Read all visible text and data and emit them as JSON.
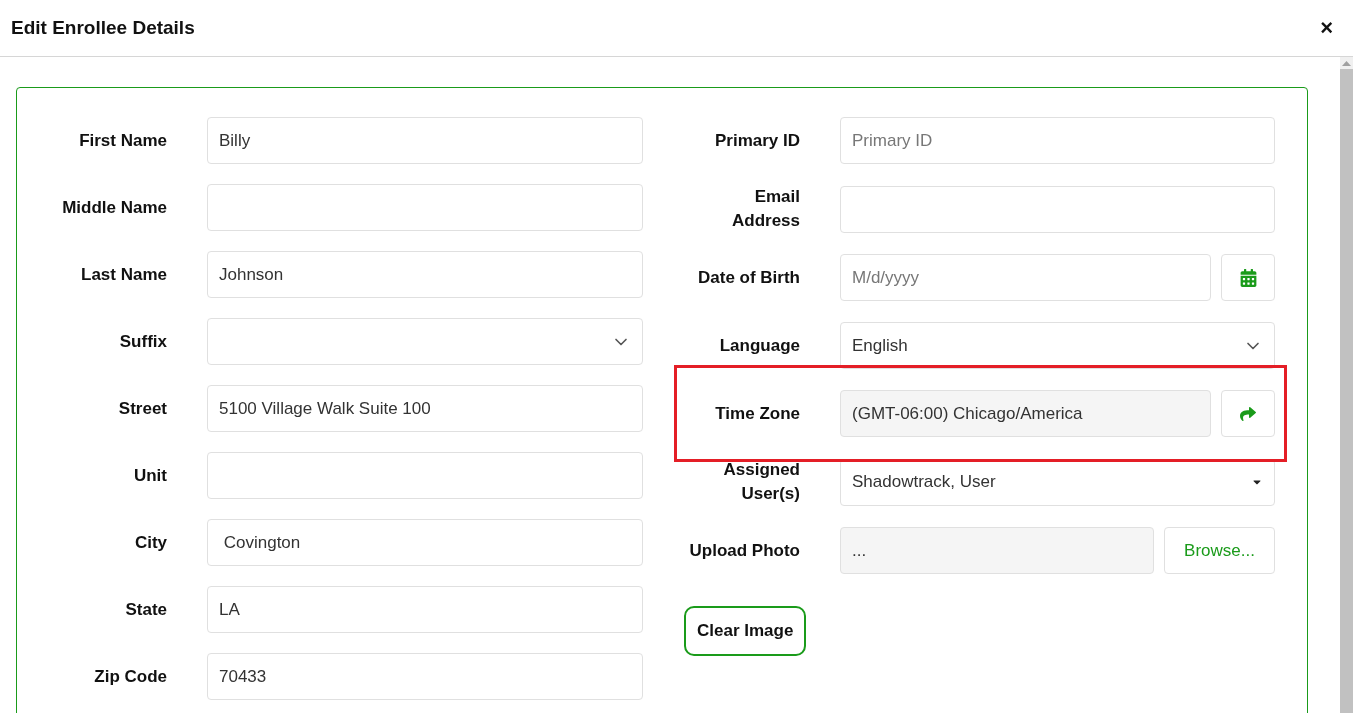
{
  "dialog": {
    "title": "Edit Enrollee Details",
    "close": "×"
  },
  "left_fields": [
    {
      "label": "First Name",
      "kind": "text",
      "value": "Billy"
    },
    {
      "label": "Middle Name",
      "kind": "text"
    },
    {
      "label": "Last Name",
      "kind": "text",
      "value": "Johnson"
    },
    {
      "label": "Suffix",
      "kind": "select"
    },
    {
      "label": "Street",
      "kind": "text",
      "value": "5100 Village Walk Suite 100"
    },
    {
      "label": "Unit",
      "kind": "text"
    },
    {
      "label": "City",
      "kind": "text",
      "value": " Covington"
    },
    {
      "label": "State",
      "kind": "text",
      "value": "LA"
    },
    {
      "label": "Zip Code",
      "kind": "text",
      "value": "70433"
    }
  ],
  "right_fields": [
    {
      "label": "Primary ID",
      "kind": "text",
      "placeholder": "Primary ID",
      "highlighted": false
    },
    {
      "label": "Email Address",
      "kind": "text",
      "highlighted": false
    },
    {
      "label": "Date of Birth",
      "kind": "date",
      "placeholder": "M/d/yyyy",
      "highlighted": false
    },
    {
      "label": "Language",
      "kind": "select",
      "value": "English",
      "highlighted": false
    },
    {
      "label": "Time Zone",
      "kind": "readonly-action",
      "value": "(GMT-06:00) Chicago/America",
      "highlighted": true
    },
    {
      "label": "Assigned User(s)",
      "kind": "dropdown",
      "value": "Shadowtrack, User",
      "highlighted": false
    },
    {
      "label": "Upload Photo",
      "kind": "file",
      "value": "...",
      "button": "Browse...",
      "highlighted": false
    }
  ],
  "clear_image_button": "Clear Image"
}
